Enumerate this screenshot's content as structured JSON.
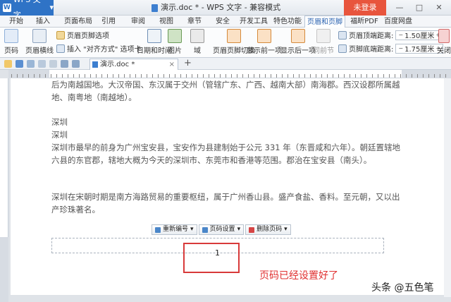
{
  "app": {
    "name": "WPS 文字",
    "logo": "W"
  },
  "window": {
    "title": "演示.doc * - WPS 文字 - 兼容模式",
    "login_label": "未登录",
    "minimize": "—",
    "maximize": "□",
    "close": "✕"
  },
  "menu_tabs": [
    "开始",
    "插入",
    "页面布局",
    "引用",
    "审阅",
    "视图",
    "章节",
    "安全",
    "开发工具",
    "特色功能",
    "页眉和页脚",
    "福昕PDF",
    "百度网盘"
  ],
  "ribbon": {
    "page_number": "页码",
    "header_line": "页眉横线",
    "date_time": "日期和时间",
    "picture": "图片",
    "field": "域",
    "header_options": "页眉页脚选项",
    "insert_align_tab": "插入 \"对齐方式\" 选项卡",
    "switch": "页眉页脚切换",
    "show_prev": "显示前一项",
    "show_next": "显示后一项",
    "same_prev": "同前节",
    "header_top_label": "页眉顶端距离:",
    "header_top_value": "1.50厘米",
    "footer_bottom_label": "页脚底端距离:",
    "footer_bottom_value": "1.75厘米",
    "close": "关闭"
  },
  "doc_tab": {
    "name": "演示.doc *",
    "close": "×",
    "new_tab": "+"
  },
  "document": {
    "para1": "后为南越国地。大汉帝国、东汉属于交州（管辖广东、广西、越南大部）南海郡。西汉设郡所属越地、南粤地（南越地）。",
    "line_sz1": "深圳",
    "line_sz2": "深圳",
    "para2": "深圳市最早的前身为广州宝安县，宝安作为县建制始于公元 331 年（东晋咸和六年）。朝廷置辖地六县的东官郡，辖地大概为今天的深圳市、东莞市和香港等范围。郡治在宝安县（南头）。",
    "para3": "深圳在宋朝时期是南方海路贸易的重要枢纽，属于广州香山县。盛产食盐、香料。至元朝，又以出产珍珠著名。"
  },
  "footer_toolbar": {
    "renumber": "重新编号",
    "page_settings": "页码设置",
    "delete_page_number": "删除页码"
  },
  "footer": {
    "page_number": "1"
  },
  "annotation": "页码已经设置好了",
  "watermark": "头条 @五色笔",
  "colors": {
    "accent": "#2f73c6",
    "login": "#e8553d",
    "annotation": "#e03030"
  }
}
